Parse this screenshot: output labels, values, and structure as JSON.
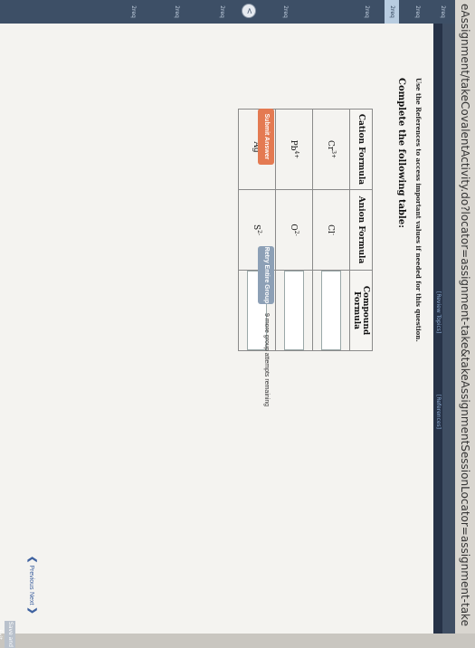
{
  "browser": {
    "url": "eAssignment/takeCovalentActivity.do?locator=assignment-take&takeAssignmentSessionLocator=assignment-take"
  },
  "sidebar": {
    "top_label": "",
    "items": [
      "2req",
      "2req",
      "2req",
      "2req",
      "2req",
      "2req",
      "2req",
      "2req"
    ],
    "toggle": "<"
  },
  "header": {
    "review_topics": "[Review Topics]",
    "references": "[References]"
  },
  "question": {
    "reference_note": "Use the References to access important values if needed for this question.",
    "prompt": "Complete the following table:",
    "columns": [
      "Cation Formula",
      "Anion Formula",
      "Compound Formula"
    ],
    "rows": [
      {
        "cation_base": "Cr",
        "cation_charge": "3+",
        "anion_base": "Cl",
        "anion_charge": "-"
      },
      {
        "cation_base": "Pb",
        "cation_charge": "4+",
        "anion_base": "O",
        "anion_charge": "2-"
      },
      {
        "cation_base": "Ag",
        "cation_charge": "+",
        "anion_base": "S",
        "anion_charge": "2-"
      }
    ]
  },
  "actions": {
    "submit": "Submit Answer",
    "retry": "Retry Entire Group",
    "attempts": "9 more group attempts remaining"
  },
  "nav": {
    "previous": "Previous",
    "next": "Next",
    "save_exit": "Save and Exit"
  },
  "colors": {
    "submit": "#e47a52",
    "retry": "#8da0b6",
    "sidebar": "#3d4f66"
  }
}
